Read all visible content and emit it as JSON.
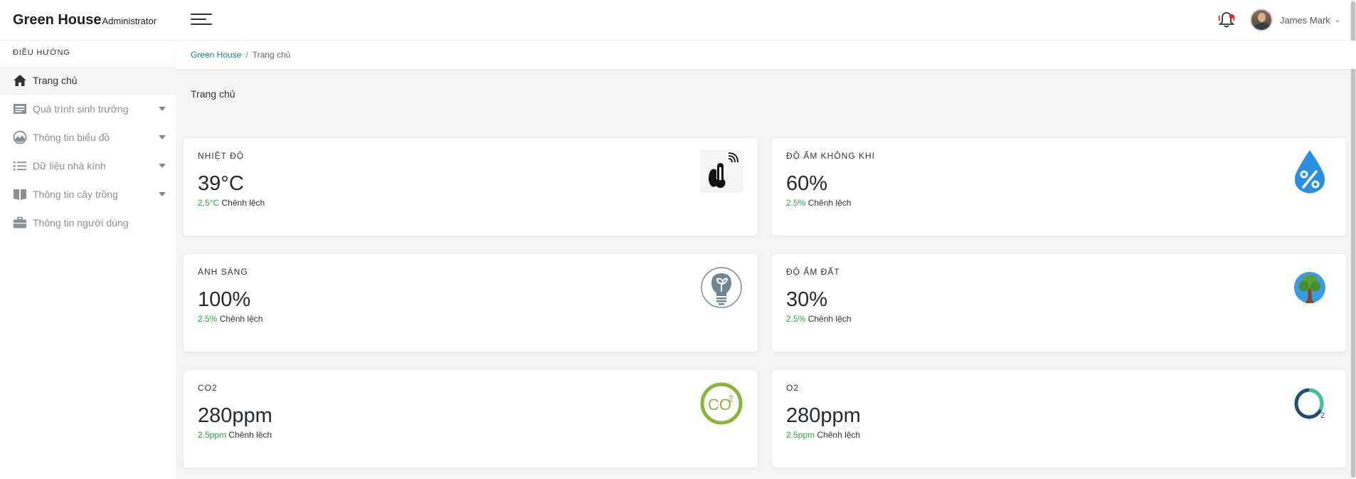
{
  "header": {
    "brand": "Green House",
    "role": "Administrator",
    "user_name": "James Mark"
  },
  "sidebar": {
    "heading": "ĐIỀU HƯỚNG",
    "items": [
      {
        "label": "Trang chủ",
        "icon": "home-icon",
        "active": true
      },
      {
        "label": "Quá trình sinh trưởng",
        "icon": "newspaper-icon"
      },
      {
        "label": "Thông tin biểu đồ",
        "icon": "chart-icon"
      },
      {
        "label": "Dữ liệu nhà kính",
        "icon": "list-icon"
      },
      {
        "label": "Thông tin cây trồng",
        "icon": "book-icon"
      },
      {
        "label": "Thông tin người dùng",
        "icon": "briefcase-icon"
      }
    ]
  },
  "breadcrumb": {
    "root": "Green House",
    "separator": "/",
    "current": "Trang chủ"
  },
  "page": {
    "title": "Trang chủ"
  },
  "cards": [
    {
      "label": "NHIỆT ĐỘ",
      "value": "39°C",
      "diff_value": "2.5°C",
      "diff_text": "Chênh lệch",
      "icon": "thermometer-icon"
    },
    {
      "label": "ĐỘ ẨM KHÔNG KHI",
      "value": "60%",
      "diff_value": "2.5%",
      "diff_text": "Chênh lệch",
      "icon": "humidity-drop-icon"
    },
    {
      "label": "ÁNH SÁNG",
      "value": "100%",
      "diff_value": "2.5%",
      "diff_text": "Chênh lệch",
      "icon": "lightbulb-icon"
    },
    {
      "label": "ĐỘ ẨM ĐẤT",
      "value": "30%",
      "diff_value": "2.5%",
      "diff_text": "Chênh lệch",
      "icon": "tree-icon"
    },
    {
      "label": "CO2",
      "value": "280ppm",
      "diff_value": "2.5ppm",
      "diff_text": "Chênh lệch",
      "icon": "co2-icon",
      "icon_text": "CO"
    },
    {
      "label": "O2",
      "value": "280ppm",
      "diff_value": "2.5ppm",
      "diff_text": "Chênh lệch",
      "icon": "o2-icon"
    }
  ],
  "colors": {
    "accent_link": "#1a73c8",
    "diff_green": "#28a745",
    "co2_green": "#8cb33a",
    "drop_blue": "#2a8fe0"
  }
}
